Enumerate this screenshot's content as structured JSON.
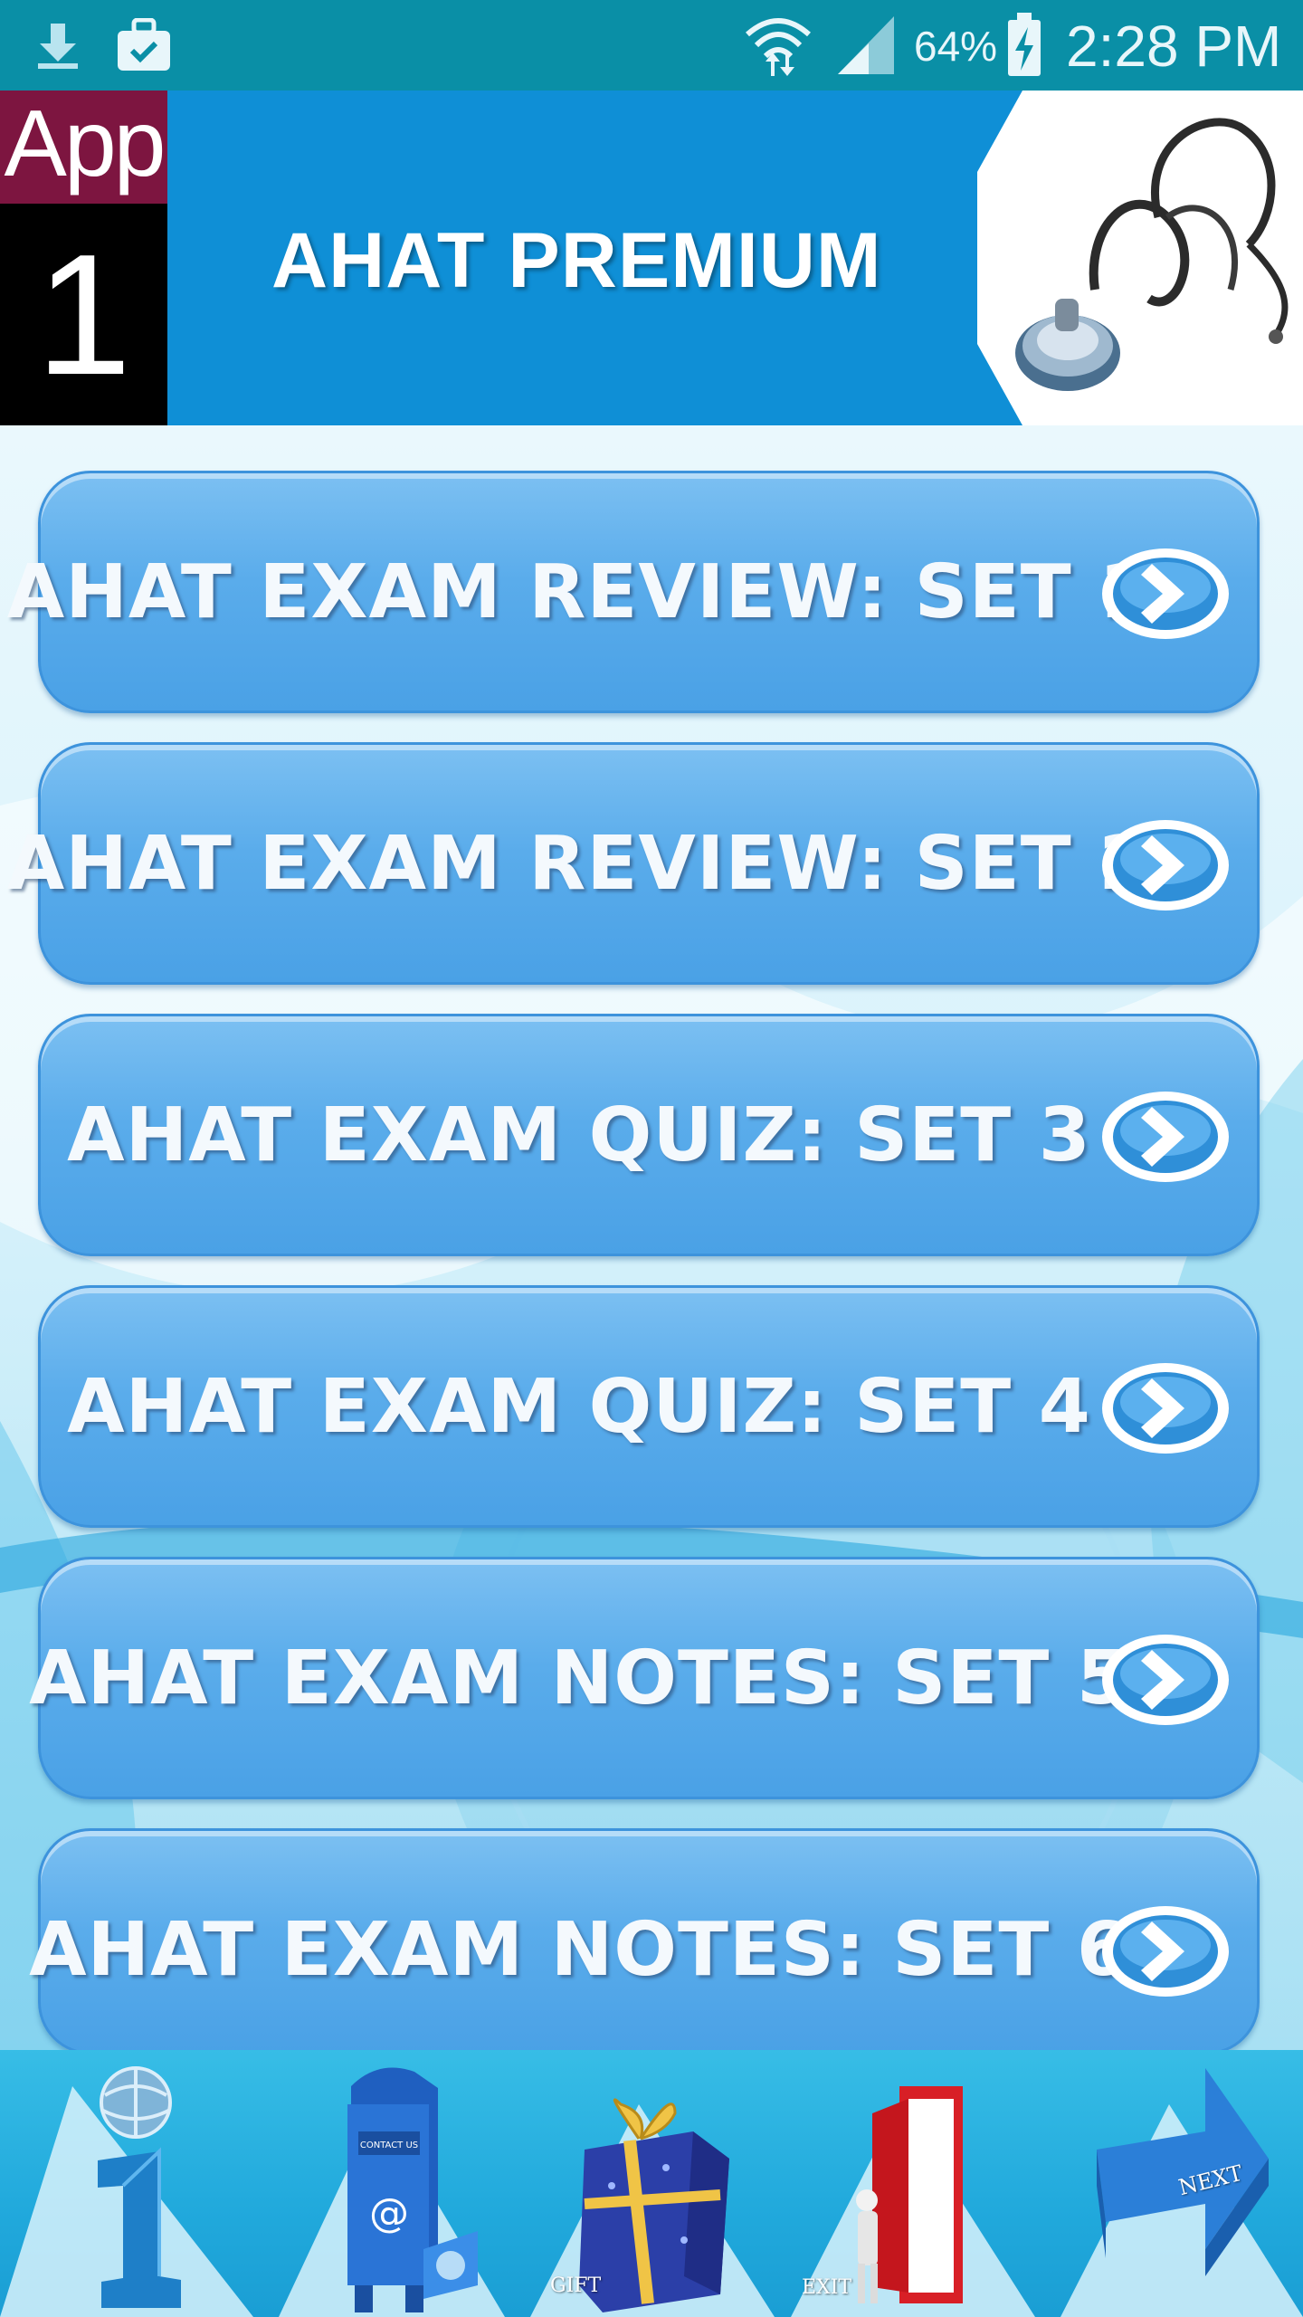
{
  "status_bar": {
    "battery": "64%",
    "time": "2:28 PM",
    "icons": [
      "download-icon",
      "briefcase-icon",
      "wifi-icon",
      "signal-icon",
      "battery-charging-icon"
    ]
  },
  "header": {
    "badge_top": "App",
    "badge_bottom": "1",
    "title": "AHAT PREMIUM",
    "image": "stethoscope-icon"
  },
  "menu": [
    {
      "label": "AHAT EXAM REVIEW: SET 1",
      "icon": "chevron-right-icon"
    },
    {
      "label": "AHAT EXAM REVIEW: SET 2",
      "icon": "chevron-right-icon"
    },
    {
      "label": "AHAT EXAM QUIZ: SET 3",
      "icon": "chevron-right-icon"
    },
    {
      "label": "AHAT EXAM QUIZ: SET 4",
      "icon": "chevron-right-icon"
    },
    {
      "label": "AHAT EXAM NOTES: SET 5",
      "icon": "chevron-right-icon"
    },
    {
      "label": "AHAT EXAM NOTES: SET 6",
      "icon": "chevron-right-icon"
    }
  ],
  "toolbar": {
    "info": {
      "icon": "info-globe-icon"
    },
    "contact": {
      "icon": "mailbox-icon",
      "mailbox_label": "CONTACT US",
      "at": "@"
    },
    "gift": {
      "icon": "gift-icon",
      "caption": "GIFT"
    },
    "exit": {
      "icon": "exit-door-icon",
      "caption": "EXIT"
    },
    "next": {
      "icon": "next-arrow-icon",
      "caption": "NEXT"
    }
  },
  "colors": {
    "status_bar": "#0a8fa6",
    "header_blue": "#0f8fd6",
    "badge_maroon": "#7d1540",
    "button_blue": "#5aaceb",
    "toolbar_blue": "#21a9dc"
  }
}
